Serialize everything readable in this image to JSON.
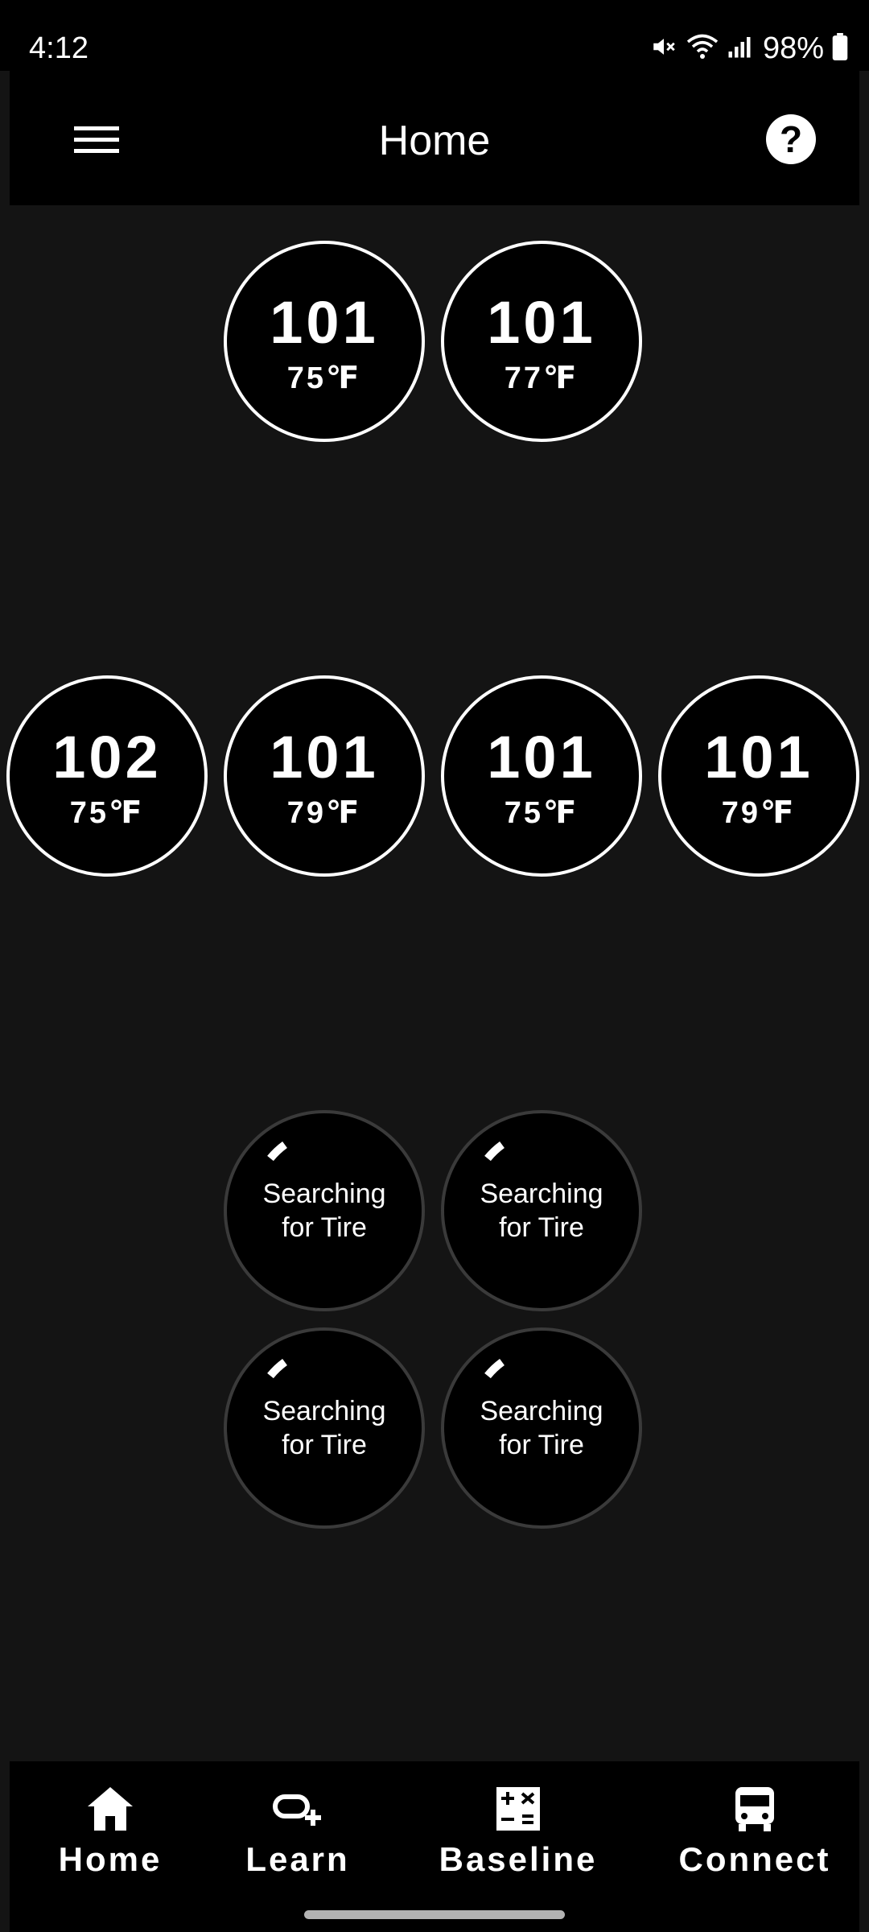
{
  "status_bar": {
    "time": "4:12",
    "battery": "98%",
    "icons": [
      "mute-icon",
      "wifi-icon",
      "signal-icon",
      "battery-icon"
    ]
  },
  "app_bar": {
    "title": "Home",
    "menu_icon": "hamburger-menu-icon",
    "help_label": "?"
  },
  "front_axle": [
    {
      "pressure": "101",
      "temp": "75℉"
    },
    {
      "pressure": "101",
      "temp": "77℉"
    }
  ],
  "rear_axle": [
    {
      "pressure": "102",
      "temp": "75℉"
    },
    {
      "pressure": "101",
      "temp": "79℉"
    },
    {
      "pressure": "101",
      "temp": "75℉"
    },
    {
      "pressure": "101",
      "temp": "79℉"
    }
  ],
  "searching_tires": [
    {
      "line1": "Searching",
      "line2": "for Tire"
    },
    {
      "line1": "Searching",
      "line2": "for Tire"
    },
    {
      "line1": "Searching",
      "line2": "for Tire"
    },
    {
      "line1": "Searching",
      "line2": "for Tire"
    }
  ],
  "bottom_nav": [
    {
      "label": "Home",
      "icon": "home-icon"
    },
    {
      "label": "Learn",
      "icon": "link-add-icon"
    },
    {
      "label": "Baseline",
      "icon": "calculator-icon"
    },
    {
      "label": "Connect",
      "icon": "bus-icon"
    }
  ],
  "colors": {
    "background": "#141414",
    "bar": "#000000",
    "accent": "#ffffff",
    "searching_ring": "#3a3a3a"
  }
}
